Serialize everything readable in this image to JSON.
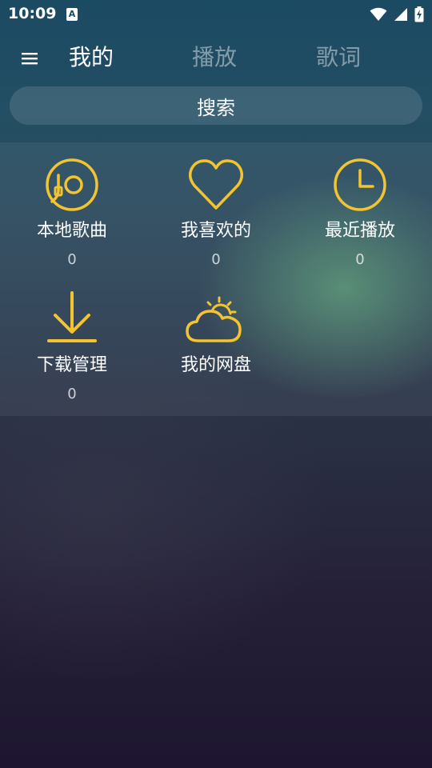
{
  "status_bar": {
    "time": "10:09",
    "notification_glyph": "A",
    "icons": [
      "wifi-icon",
      "signal-icon",
      "battery-charging-icon"
    ]
  },
  "app_bar": {
    "menu_icon": "hamburger-menu-icon",
    "tabs": [
      {
        "label": "我的",
        "active": true
      },
      {
        "label": "播放",
        "active": false
      },
      {
        "label": "歌词",
        "active": false
      }
    ]
  },
  "search": {
    "label": "搜索"
  },
  "grid": {
    "accent_color": "#f4c430",
    "items": [
      {
        "label": "本地歌曲",
        "count": "0",
        "icon": "vinyl-record-icon"
      },
      {
        "label": "我喜欢的",
        "count": "0",
        "icon": "heart-icon"
      },
      {
        "label": "最近播放",
        "count": "0",
        "icon": "clock-icon"
      },
      {
        "label": "下载管理",
        "count": "0",
        "icon": "download-icon"
      },
      {
        "label": "我的网盘",
        "count": "",
        "icon": "cloud-sun-icon"
      }
    ]
  }
}
